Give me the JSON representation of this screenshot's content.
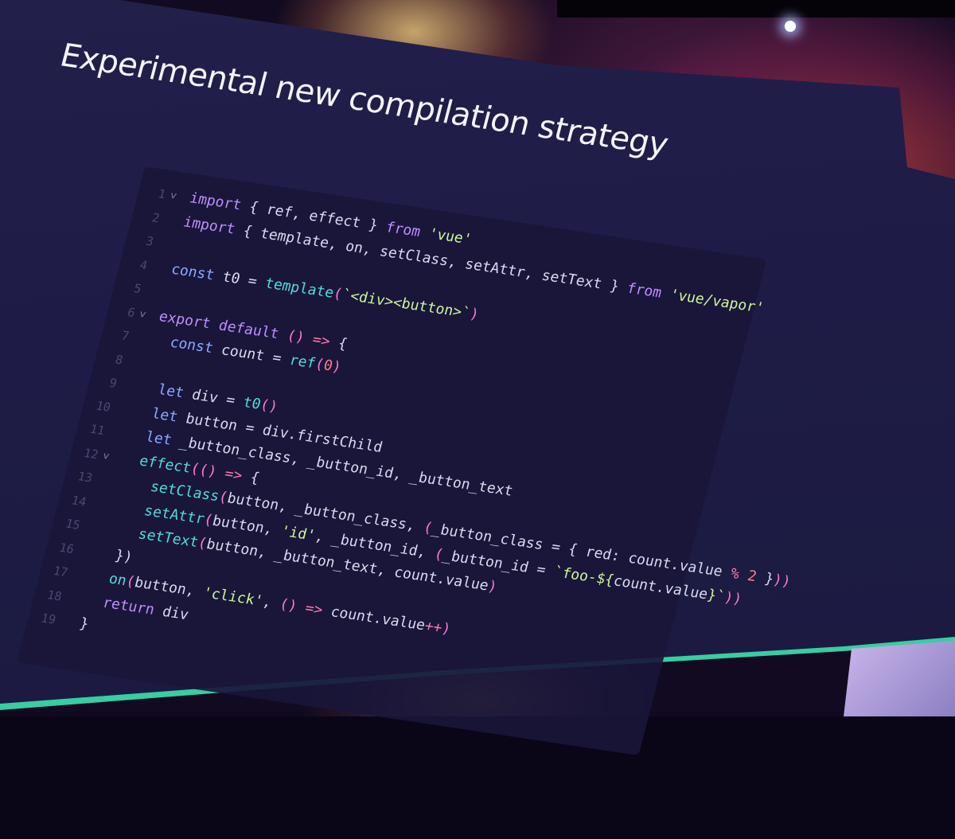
{
  "slide": {
    "title": "Experimental new compilation strategy"
  },
  "code": {
    "language": "javascript",
    "lines": [
      {
        "n": "1",
        "fold": "v",
        "tokens": [
          [
            "kw2",
            "import"
          ],
          [
            "punct",
            " { ref, effect } "
          ],
          [
            "kw2",
            "from"
          ],
          [
            "punct",
            " "
          ],
          [
            "str",
            "'vue'"
          ]
        ]
      },
      {
        "n": "2",
        "fold": "",
        "tokens": [
          [
            "kw2",
            "import"
          ],
          [
            "punct",
            " { template, on, setClass, setAttr, setText } "
          ],
          [
            "kw2",
            "from"
          ],
          [
            "punct",
            " "
          ],
          [
            "str",
            "'vue/vapor'"
          ]
        ]
      },
      {
        "n": "3",
        "fold": "",
        "tokens": []
      },
      {
        "n": "4",
        "fold": "",
        "tokens": [
          [
            "kw",
            "const"
          ],
          [
            "punct",
            " t0 = "
          ],
          [
            "fn",
            "template"
          ],
          [
            "paren",
            "("
          ],
          [
            "str",
            "`<div><button>`"
          ],
          [
            "paren",
            ")"
          ]
        ]
      },
      {
        "n": "5",
        "fold": "",
        "tokens": []
      },
      {
        "n": "6",
        "fold": "v",
        "tokens": [
          [
            "kw2",
            "export default"
          ],
          [
            "punct",
            " "
          ],
          [
            "paren",
            "()"
          ],
          [
            "punct",
            " "
          ],
          [
            "op",
            "=>"
          ],
          [
            "punct",
            " {"
          ]
        ]
      },
      {
        "n": "7",
        "fold": "",
        "tokens": [
          [
            "punct",
            "  "
          ],
          [
            "kw",
            "const"
          ],
          [
            "punct",
            " count = "
          ],
          [
            "fn",
            "ref"
          ],
          [
            "paren",
            "("
          ],
          [
            "num",
            "0"
          ],
          [
            "paren",
            ")"
          ]
        ]
      },
      {
        "n": "8",
        "fold": "",
        "tokens": []
      },
      {
        "n": "9",
        "fold": "",
        "tokens": [
          [
            "punct",
            "  "
          ],
          [
            "kw",
            "let"
          ],
          [
            "punct",
            " div = "
          ],
          [
            "fn",
            "t0"
          ],
          [
            "paren",
            "()"
          ]
        ]
      },
      {
        "n": "10",
        "fold": "",
        "tokens": [
          [
            "punct",
            "  "
          ],
          [
            "kw",
            "let"
          ],
          [
            "punct",
            " button = div.firstChild"
          ]
        ]
      },
      {
        "n": "11",
        "fold": "",
        "tokens": [
          [
            "punct",
            "  "
          ],
          [
            "kw",
            "let"
          ],
          [
            "punct",
            " _button_class, _button_id, _button_text"
          ]
        ]
      },
      {
        "n": "12",
        "fold": "v",
        "tokens": [
          [
            "punct",
            "  "
          ],
          [
            "fn",
            "effect"
          ],
          [
            "paren",
            "(()"
          ],
          [
            "punct",
            " "
          ],
          [
            "op",
            "=>"
          ],
          [
            "punct",
            " {"
          ]
        ]
      },
      {
        "n": "13",
        "fold": "",
        "tokens": [
          [
            "punct",
            "    "
          ],
          [
            "fn",
            "setClass"
          ],
          [
            "paren",
            "("
          ],
          [
            "punct",
            "button, _button_class, "
          ],
          [
            "paren",
            "("
          ],
          [
            "punct",
            "_button_class = { red: count.value "
          ],
          [
            "op",
            "%"
          ],
          [
            "punct",
            " "
          ],
          [
            "num",
            "2"
          ],
          [
            "punct",
            " }"
          ],
          [
            "paren",
            "))"
          ]
        ]
      },
      {
        "n": "14",
        "fold": "",
        "tokens": [
          [
            "punct",
            "    "
          ],
          [
            "fn",
            "setAttr"
          ],
          [
            "paren",
            "("
          ],
          [
            "punct",
            "button, "
          ],
          [
            "str",
            "'id'"
          ],
          [
            "punct",
            ", _button_id, "
          ],
          [
            "paren",
            "("
          ],
          [
            "punct",
            "_button_id = "
          ],
          [
            "str",
            "`foo-${"
          ],
          [
            "punct",
            "count.value"
          ],
          [
            "str",
            "}`"
          ],
          [
            "paren",
            "))"
          ]
        ]
      },
      {
        "n": "15",
        "fold": "",
        "tokens": [
          [
            "punct",
            "    "
          ],
          [
            "fn",
            "setText"
          ],
          [
            "paren",
            "("
          ],
          [
            "punct",
            "button, _button_text, count.value"
          ],
          [
            "paren",
            ")"
          ]
        ]
      },
      {
        "n": "16",
        "fold": "",
        "tokens": [
          [
            "punct",
            "  })"
          ]
        ]
      },
      {
        "n": "17",
        "fold": "",
        "tokens": [
          [
            "punct",
            "  "
          ],
          [
            "fn",
            "on"
          ],
          [
            "paren",
            "("
          ],
          [
            "punct",
            "button, "
          ],
          [
            "str",
            "'click'"
          ],
          [
            "punct",
            ", "
          ],
          [
            "paren",
            "()"
          ],
          [
            "punct",
            " "
          ],
          [
            "op",
            "=>"
          ],
          [
            "punct",
            " count.value"
          ],
          [
            "op",
            "++"
          ],
          [
            "paren",
            ")"
          ]
        ]
      },
      {
        "n": "18",
        "fold": "",
        "tokens": [
          [
            "punct",
            "  "
          ],
          [
            "kw2",
            "return"
          ],
          [
            "punct",
            " div"
          ]
        ]
      },
      {
        "n": "19",
        "fold": "",
        "tokens": [
          [
            "punct",
            "}"
          ]
        ]
      }
    ]
  }
}
